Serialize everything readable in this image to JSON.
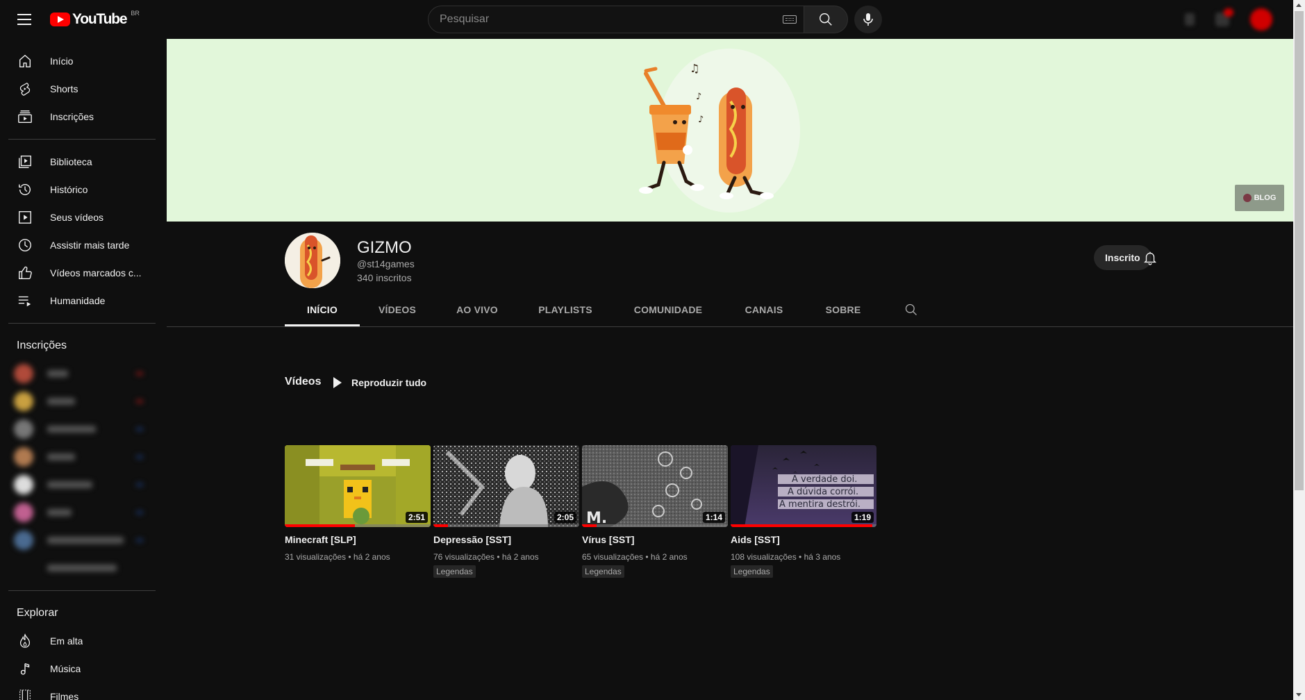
{
  "header": {
    "logo_text": "YouTube",
    "country": "BR",
    "search_placeholder": "Pesquisar"
  },
  "sidebar": {
    "main": [
      {
        "label": "Início",
        "icon": "home-icon"
      },
      {
        "label": "Shorts",
        "icon": "shorts-icon"
      },
      {
        "label": "Inscrições",
        "icon": "subscriptions-icon"
      }
    ],
    "library": [
      {
        "label": "Biblioteca",
        "icon": "library-icon"
      },
      {
        "label": "Histórico",
        "icon": "history-icon"
      },
      {
        "label": "Seus vídeos",
        "icon": "your-videos-icon"
      },
      {
        "label": "Assistir mais tarde",
        "icon": "watch-later-icon"
      },
      {
        "label": "Vídeos marcados c...",
        "icon": "liked-videos-icon"
      },
      {
        "label": "Humanidade",
        "icon": "playlist-icon"
      }
    ],
    "subscriptions_title": "Inscrições",
    "explore_title": "Explorar",
    "explore": [
      {
        "label": "Em alta",
        "icon": "trending-icon"
      },
      {
        "label": "Música",
        "icon": "music-icon"
      },
      {
        "label": "Filmes",
        "icon": "movies-icon"
      }
    ]
  },
  "banner": {
    "link_label": "BLOG"
  },
  "channel": {
    "name": "GIZMO",
    "handle": "@st14games",
    "subscribers": "340 inscritos",
    "subscribe_label": "Inscrito"
  },
  "tabs": [
    "INÍCIO",
    "VÍDEOS",
    "AO VIVO",
    "PLAYLISTS",
    "COMUNIDADE",
    "CANAIS",
    "SOBRE"
  ],
  "shelf": {
    "title": "Vídeos",
    "play_all": "Reproduzir tudo"
  },
  "videos": [
    {
      "title": "Minecraft [SLP]",
      "meta": "31 visualizações • há 2 anos",
      "duration": "2:51",
      "badge": "",
      "progress": 0.48
    },
    {
      "title": "Depressão [SST]",
      "meta": "76 visualizações • há 2 anos",
      "duration": "2:05",
      "badge": "Legendas",
      "progress": 0.1
    },
    {
      "title": "Vírus [SST]",
      "meta": "65 visualizações • há 2 anos",
      "duration": "1:14",
      "badge": "Legendas",
      "progress": 0.1
    },
    {
      "title": "Aids [SST]",
      "meta": "108 visualizações • há 3 anos",
      "duration": "1:19",
      "badge": "Legendas",
      "progress": 0.97
    }
  ],
  "thumbnail_text": {
    "virus_logo": "M.",
    "aids_lines": [
      "A verdade doi.",
      "A dúvida corrói.",
      "A mentira destrói."
    ]
  },
  "colors": {
    "background": "#0f0f0f",
    "accent_red": "#ff0000",
    "banner_bg": "#e2f7da"
  }
}
